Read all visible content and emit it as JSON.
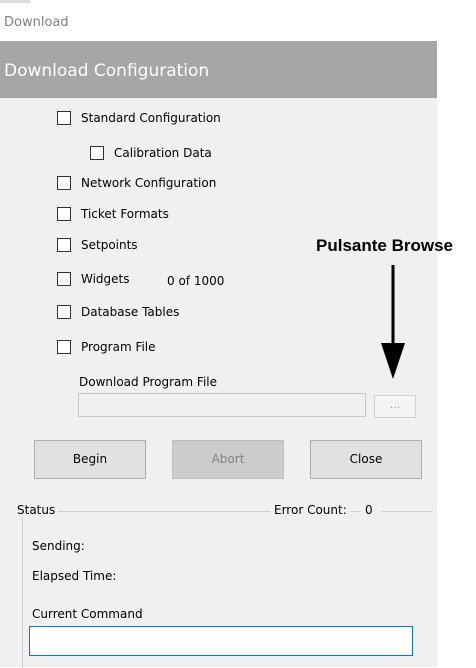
{
  "window": {
    "title": "Download"
  },
  "header": {
    "title": "Download Configuration"
  },
  "options": [
    {
      "label": "Standard Configuration",
      "checked": false
    },
    {
      "label": "Calibration Data",
      "checked": false
    },
    {
      "label": "Network Configuration",
      "checked": false
    },
    {
      "label": "Ticket Formats",
      "checked": false
    },
    {
      "label": "Setpoints",
      "checked": false
    },
    {
      "label": "Widgets",
      "checked": false
    },
    {
      "label": "Database Tables",
      "checked": false
    },
    {
      "label": "Program File",
      "checked": false
    }
  ],
  "widgets_count": "0 of 1000",
  "download_program": {
    "label": "Download Program File",
    "value": "",
    "browse_label": "..."
  },
  "buttons": {
    "begin": "Begin",
    "abort": "Abort",
    "close": "Close"
  },
  "status": {
    "title": "Status",
    "error_count_label": "Error Count:",
    "error_count": "0",
    "sending_label": "Sending:",
    "elapsed_label": "Elapsed Time:",
    "current_command_label": "Current Command",
    "current_command_value": ""
  },
  "annotation": {
    "text": "Pulsante Browse"
  },
  "colors": {
    "header_bg": "#a6a6a6",
    "panel_bg": "#f0f0f0",
    "focus_border": "#0078d7"
  }
}
